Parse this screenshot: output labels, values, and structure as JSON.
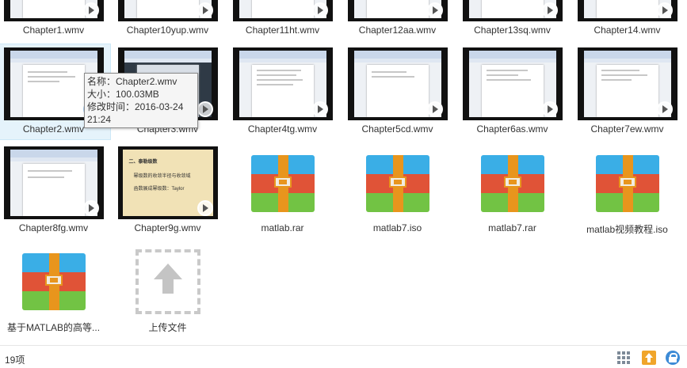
{
  "files": [
    {
      "name": "Chapter1.wmv",
      "kind": "video"
    },
    {
      "name": "Chapter10yup.wmv",
      "kind": "video"
    },
    {
      "name": "Chapter11ht.wmv",
      "kind": "video"
    },
    {
      "name": "Chapter12aa.wmv",
      "kind": "video"
    },
    {
      "name": "Chapter13sq.wmv",
      "kind": "video"
    },
    {
      "name": "Chapter14.wmv",
      "kind": "video"
    },
    {
      "name": "Chapter2.wmv",
      "kind": "video"
    },
    {
      "name": "Chapter3.wmv",
      "kind": "video"
    },
    {
      "name": "Chapter4tg.wmv",
      "kind": "video"
    },
    {
      "name": "Chapter5cd.wmv",
      "kind": "video"
    },
    {
      "name": "Chapter6as.wmv",
      "kind": "video"
    },
    {
      "name": "Chapter7ew.wmv",
      "kind": "video"
    },
    {
      "name": "Chapter8fg.wmv",
      "kind": "video"
    },
    {
      "name": "Chapter9g.wmv",
      "kind": "video"
    },
    {
      "name": "matlab.rar",
      "kind": "archive"
    },
    {
      "name": "matlab7.iso",
      "kind": "archive"
    },
    {
      "name": "matlab7.rar",
      "kind": "archive"
    },
    {
      "name": "matlab视频教程.iso",
      "kind": "archive"
    },
    {
      "name": "基于MATLAB的高等...",
      "kind": "archive"
    }
  ],
  "upload_tile": {
    "label": "上传文件"
  },
  "tooltip": {
    "line1": "名称：Chapter2.wmv",
    "line2": "大小：100.03MB",
    "line3": "修改时间：2016-03-24",
    "line4": "21:24"
  },
  "slide_text": {
    "heading": "二、泰勒级数",
    "bullet1": "幂级数的收敛半径与收敛域",
    "bullet2": "函数展成幂级数：Taylor"
  },
  "status": {
    "count": "19项",
    "icons": [
      "grid-view-icon",
      "upload-icon",
      "lock-icon"
    ]
  },
  "colors": {
    "hover_bg": "#e5f3fb",
    "archive_blue": "#3aaee6",
    "archive_red": "#e05337",
    "archive_green": "#72c344",
    "archive_strap": "#e8951d",
    "play_active": "#3f8ad8",
    "lock_blue": "#3d8bd6",
    "upload_orange": "#f0a52a"
  }
}
